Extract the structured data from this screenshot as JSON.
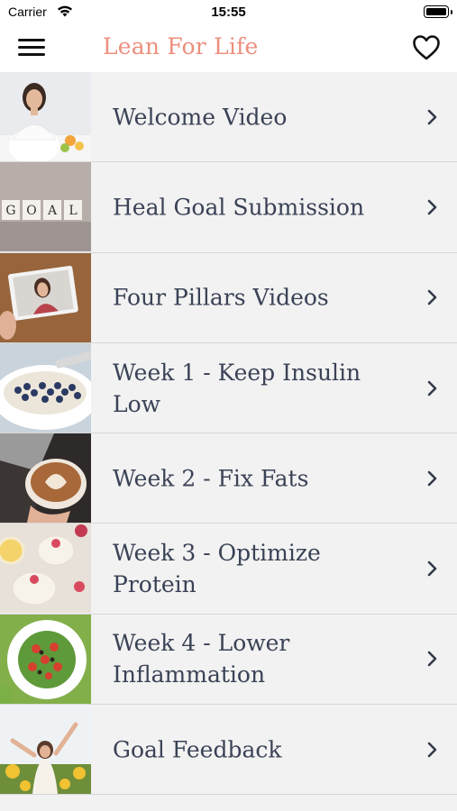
{
  "status_bar": {
    "carrier": "Carrier",
    "time": "15:55",
    "battery_level": 1.0
  },
  "header": {
    "title": "Lean For Life",
    "menu_icon": "hamburger-menu-icon",
    "favorite_icon": "heart-outline-icon"
  },
  "colors": {
    "title": "#ec8f7e",
    "label": "#3a4256",
    "background": "#f2f2f2",
    "divider": "#d6d6d6"
  },
  "items": [
    {
      "label": "Welcome Video",
      "thumbnail": "woman-at-desk-image"
    },
    {
      "label": "Heal Goal Submission",
      "thumbnail": "goal-letter-blocks-image"
    },
    {
      "label": "Four Pillars Videos",
      "thumbnail": "tablet-video-image"
    },
    {
      "label": "Week 1 - Keep Insulin Low",
      "thumbnail": "blueberry-bowl-image"
    },
    {
      "label": "Week 2 - Fix Fats",
      "thumbnail": "latte-art-image"
    },
    {
      "label": "Week 3 - Optimize Protein",
      "thumbnail": "yogurt-parfait-image"
    },
    {
      "label": "Week 4 - Lower Inflammation",
      "thumbnail": "salad-plate-image"
    },
    {
      "label": "Goal Feedback",
      "thumbnail": "sunflower-field-woman-image"
    }
  ]
}
